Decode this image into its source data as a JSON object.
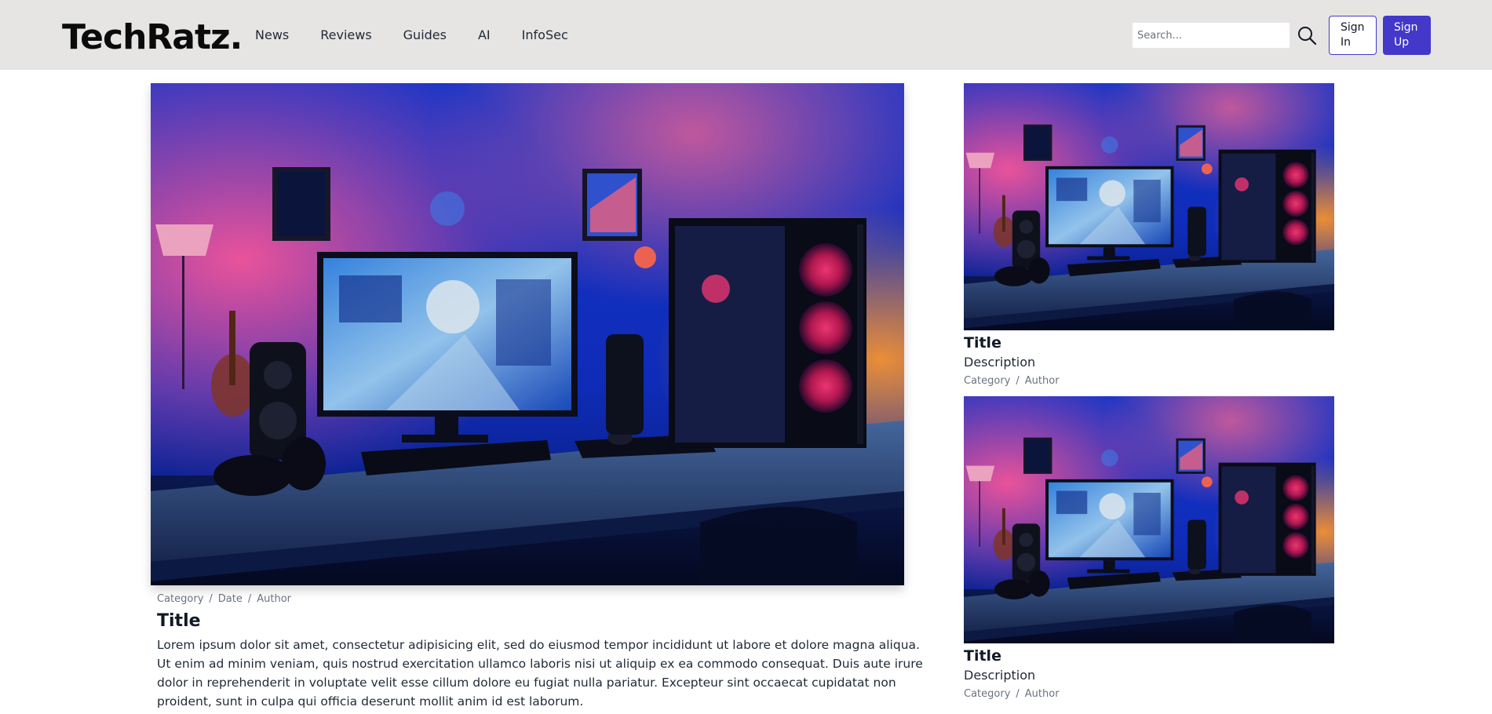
{
  "header": {
    "logo": "TechRatz.",
    "nav": [
      "News",
      "Reviews",
      "Guides",
      "AI",
      "InfoSec"
    ],
    "search": {
      "placeholder": "Search...",
      "value": ""
    },
    "search_icon": "search-icon",
    "signin_label": "Sign In",
    "signup_label": "Sign Up"
  },
  "feature": {
    "image": "gaming-pc-desk-photo",
    "meta": [
      "Category",
      "Date",
      "Author"
    ],
    "title": "Title",
    "body": "Lorem ipsum dolor sit amet, consectetur adipisicing elit, sed do eiusmod tempor incididunt ut labore et dolore magna aliqua. Ut enim ad minim veniam, quis nostrud exercitation ullamco laboris nisi ut aliquip ex ea commodo consequat. Duis aute irure dolor in reprehenderit in voluptate velit esse cillum dolore eu fugiat nulla pariatur. Excepteur sint occaecat cupidatat non proident, sunt in culpa qui officia deserunt mollit anim id est laborum."
  },
  "cards": [
    {
      "image": "gaming-pc-desk-photo",
      "title": "Title",
      "description": "Description",
      "meta": [
        "Category",
        "Author"
      ]
    },
    {
      "image": "gaming-pc-desk-photo",
      "title": "Title",
      "description": "Description",
      "meta": [
        "Category",
        "Author"
      ]
    }
  ],
  "colors": {
    "header_bg": "#e6e5e3",
    "accent": "#4338ca",
    "meta_text": "#6b7280"
  }
}
